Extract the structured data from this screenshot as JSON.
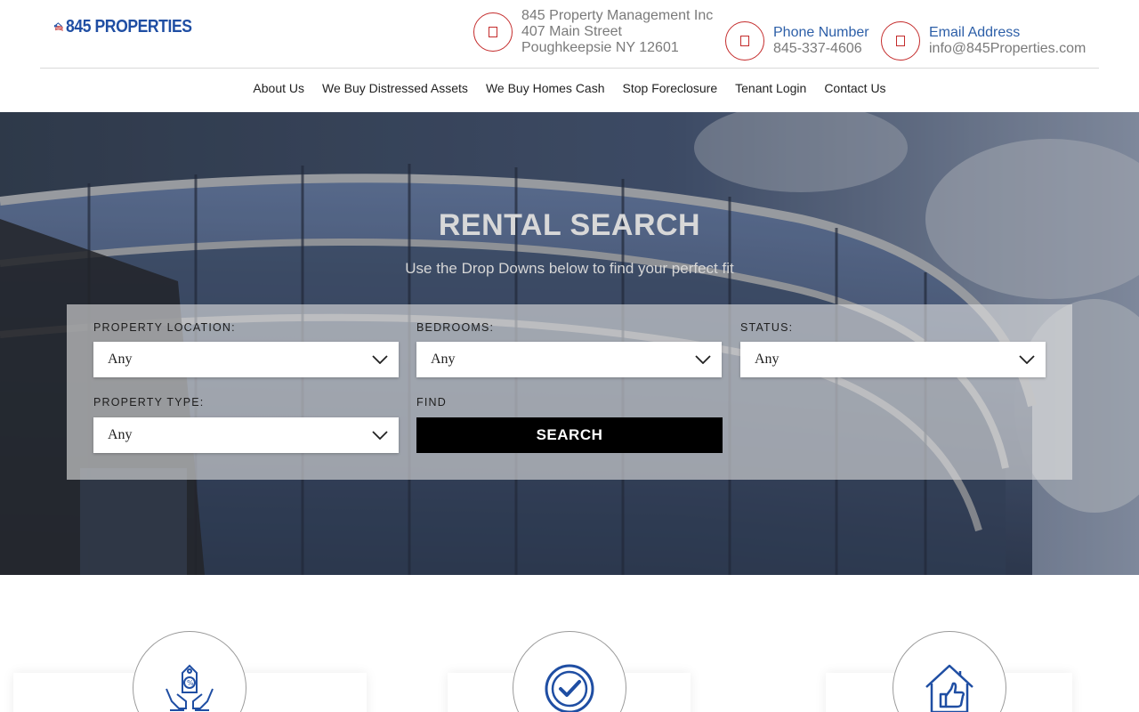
{
  "brand": {
    "logo_text": "845 PROPERTIES"
  },
  "contact": {
    "address": {
      "line1": "845 Property Management Inc",
      "line2": "407 Main Street",
      "line3": "Poughkeepsie NY 12601",
      "icon": "map-marker-icon"
    },
    "phone": {
      "label": "Phone Number",
      "value": "845-337-4606",
      "icon": "phone-icon"
    },
    "email": {
      "label": "Email Address",
      "value": "info@845Properties.com",
      "icon": "envelope-icon"
    }
  },
  "nav": {
    "items": [
      "About Us",
      "We Buy Distressed Assets",
      "We Buy Homes Cash",
      "Stop Foreclosure",
      "Tenant Login",
      "Contact Us"
    ]
  },
  "hero": {
    "title": "RENTAL SEARCH",
    "subtitle": "Use the Drop Downs below to find your perfect fit"
  },
  "search": {
    "location": {
      "label": "PROPERTY LOCATION:",
      "value": "Any"
    },
    "bedrooms": {
      "label": "BEDROOMS:",
      "value": "Any"
    },
    "status": {
      "label": "STATUS:",
      "value": "Any"
    },
    "type": {
      "label": "PROPERTY TYPE:",
      "value": "Any"
    },
    "find_label": "FIND",
    "button_label": "SEARCH"
  },
  "features": {
    "icons": [
      "discount-tag-hands-icon",
      "checkmark-circle-icon",
      "house-thumbs-up-icon"
    ]
  },
  "colors": {
    "brand_blue": "#1f4ea3",
    "accent_red": "#c42b2b",
    "link_blue": "#2d5fa8"
  }
}
